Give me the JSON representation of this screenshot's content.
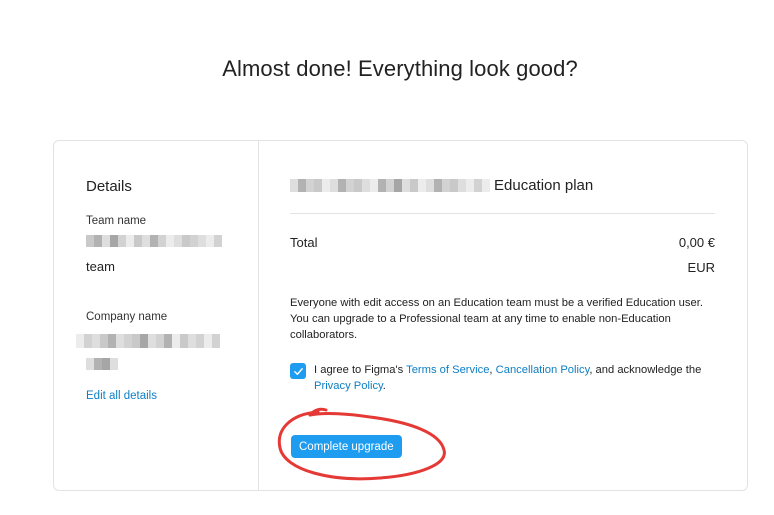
{
  "page": {
    "title": "Almost done! Everything look good?"
  },
  "details": {
    "heading": "Details",
    "team_name_label": "Team name",
    "team_name_value": "team",
    "company_name_label": "Company name",
    "edit_link": "Edit all details"
  },
  "plan": {
    "title": "Education plan",
    "total_label": "Total",
    "total_amount": "0,00 €",
    "currency": "EUR",
    "info_text": "Everyone with edit access on an Education team must be a verified Education user. You can upgrade to a Professional team at any time to enable non-Education collaborators.",
    "agree": {
      "checked": true,
      "prefix": "I agree to Figma's ",
      "terms_link": "Terms of Service",
      "comma": ", ",
      "cancellation_link": "Cancellation Policy",
      "middle": ", and acknowledge the ",
      "privacy_link": "Privacy Policy",
      "suffix": "."
    },
    "button_label": "Complete upgrade"
  },
  "colors": {
    "accent": "#1e9cf0",
    "link": "#0d7ec4",
    "annotation": "#e53935"
  },
  "icons": {
    "checkbox": "check-icon"
  }
}
